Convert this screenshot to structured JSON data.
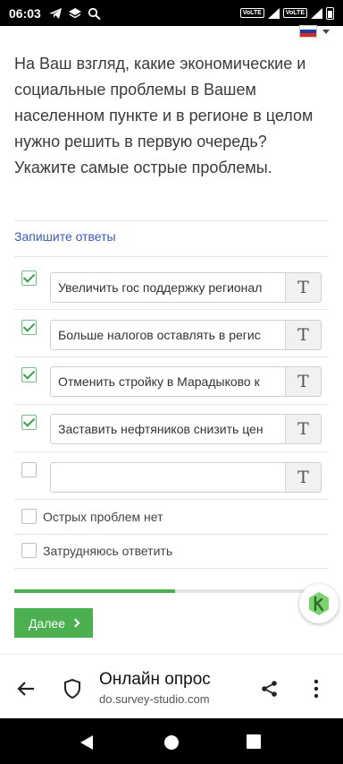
{
  "status_bar": {
    "time": "06:03",
    "indicators": [
      "telegram-icon",
      "layers-icon",
      "search-icon"
    ],
    "volte1": "VoLTE",
    "volte2": "VoLTE"
  },
  "language": {
    "selected": "ru",
    "flag_colors": [
      "#ffffff",
      "#1c3fa8",
      "#d52b1e"
    ]
  },
  "question": "На Ваш взгляд, какие экономические и социальные проблемы в Вашем населенном пункте и в регионе в целом нужно решить в первую очередь? Укажите самые острые проблемы.",
  "hint": "Запишите ответы",
  "answers": [
    {
      "checked": true,
      "value": "Увеличить гос поддержку регионал"
    },
    {
      "checked": true,
      "value": "Больше налогов оставлять в регис"
    },
    {
      "checked": true,
      "value": "Отменить стройку в Марадыково к"
    },
    {
      "checked": true,
      "value": "Заставить нефтяников снизить цен"
    },
    {
      "checked": false,
      "value": ""
    }
  ],
  "format_button_glyph": "T",
  "options": [
    {
      "label": "Острых проблем нет",
      "checked": false
    },
    {
      "label": "Затрудняюсь ответить",
      "checked": false
    }
  ],
  "progress": {
    "fraction": 0.51
  },
  "next_button": {
    "label": "Далее"
  },
  "colors": {
    "accent": "#4caf50",
    "link": "#3a5ab8",
    "text": "#3a3a3a"
  },
  "browser": {
    "title": "Онлайн опрос",
    "url": "do.survey-studio.com"
  }
}
